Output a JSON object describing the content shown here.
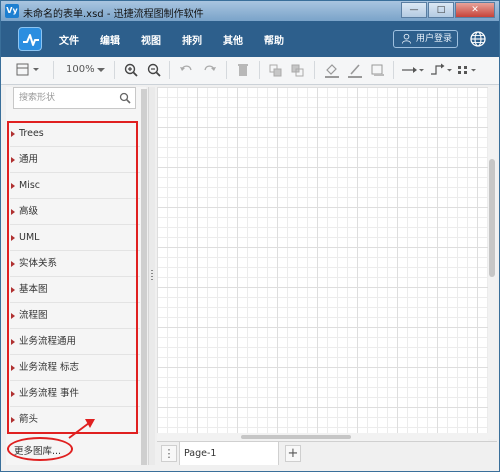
{
  "window": {
    "title": "未命名的表单.xsd - 迅捷流程图制作软件",
    "app_icon_text": "Vy",
    "minimize_glyph": "—",
    "maximize_glyph": "□",
    "close_glyph": "✕"
  },
  "menubar": {
    "logo_icon": "flowchart-logo-icon",
    "items": [
      "文件",
      "编辑",
      "视图",
      "排列",
      "其他",
      "帮助"
    ],
    "login_label": "用户登录",
    "globe_icon": "globe-icon"
  },
  "toolbar": {
    "zoom_level": "100%",
    "icons": [
      "view-toggle-icon",
      "zoom-in-icon",
      "zoom-out-icon",
      "undo-icon",
      "redo-icon",
      "delete-icon",
      "to-front-icon",
      "to-back-icon",
      "fill-color-icon",
      "line-color-icon",
      "shadow-icon",
      "connector-icon",
      "waypoint-icon",
      "more-icon"
    ]
  },
  "sidebar": {
    "search_placeholder": "搜索形状",
    "items": [
      "Trees",
      "通用",
      "Misc",
      "高级",
      "UML",
      "实体关系",
      "基本图",
      "流程图",
      "业务流程通用",
      "业务流程 标志",
      "业务流程 事件",
      "箭头"
    ],
    "more_libraries": "更多图库..."
  },
  "pages": {
    "menu_glyph": "⋮",
    "tabs": [
      "Page-1"
    ],
    "add_glyph": "+"
  },
  "colors": {
    "menubar_bg": "#2d5f8c",
    "annotation": "#e02020",
    "logo_bg": "#2b8ee0"
  }
}
